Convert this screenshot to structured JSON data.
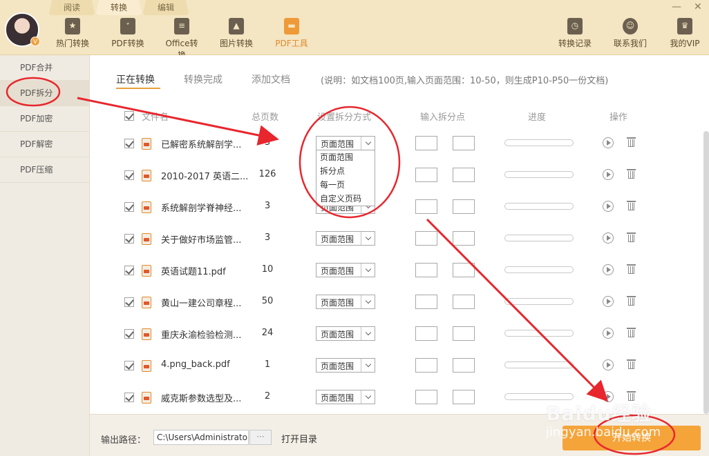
{
  "top_tabs": [
    "阅读",
    "转换",
    "编辑"
  ],
  "tools": [
    {
      "label": "热门转换",
      "icon": "star-icon"
    },
    {
      "label": "PDF转换",
      "icon": "pdf-icon"
    },
    {
      "label": "Office转换",
      "icon": "document-icon"
    },
    {
      "label": "图片转换",
      "icon": "image-icon"
    },
    {
      "label": "PDF工具",
      "icon": "toolbox-icon"
    },
    {
      "label": "转换记录",
      "icon": "clock-icon"
    },
    {
      "label": "联系我们",
      "icon": "headset-icon"
    },
    {
      "label": "我的VIP",
      "icon": "crown-icon"
    }
  ],
  "sidebar": [
    "PDF合并",
    "PDF拆分",
    "PDF加密",
    "PDF解密",
    "PDF压缩"
  ],
  "sub_tabs": [
    "正在转换",
    "转换完成",
    "添加文档"
  ],
  "note": "(说明：如文档100页,输入页面范围：10-50，则生成P10-P50一份文档)",
  "columns": {
    "file": "文件名",
    "pages": "总页数",
    "mode": "设置拆分方式",
    "split": "输入拆分点",
    "progress": "进度",
    "action": "操作"
  },
  "select_default": "页面范围",
  "dropdown_options": [
    "页面范围",
    "拆分点",
    "每一页",
    "自定义页码"
  ],
  "files": [
    {
      "name": "已解密系统解剖学...",
      "pages": "3"
    },
    {
      "name": "2010-2017 英语二...",
      "pages": "126"
    },
    {
      "name": "系统解剖学脊神经...",
      "pages": "3"
    },
    {
      "name": "关于做好市场监管...",
      "pages": "3"
    },
    {
      "name": "英语试题11.pdf",
      "pages": "10"
    },
    {
      "name": "黄山一建公司章程...",
      "pages": "50"
    },
    {
      "name": "重庆永渝检验检测...",
      "pages": "24"
    },
    {
      "name": "4.png_back.pdf",
      "pages": "1"
    },
    {
      "name": "威克斯参数选型及...",
      "pages": "2"
    }
  ],
  "output": {
    "label": "输出路径：",
    "path": "C:\\Users\\Administrator\\",
    "browse": "···",
    "open_dir": "打开目录"
  },
  "start_button": "开始转换",
  "watermark": "Baidu经验",
  "watermark_url": "jingyan.baidu.com",
  "colors": {
    "accent": "#f5a43a",
    "annotation": "#e8262d"
  }
}
